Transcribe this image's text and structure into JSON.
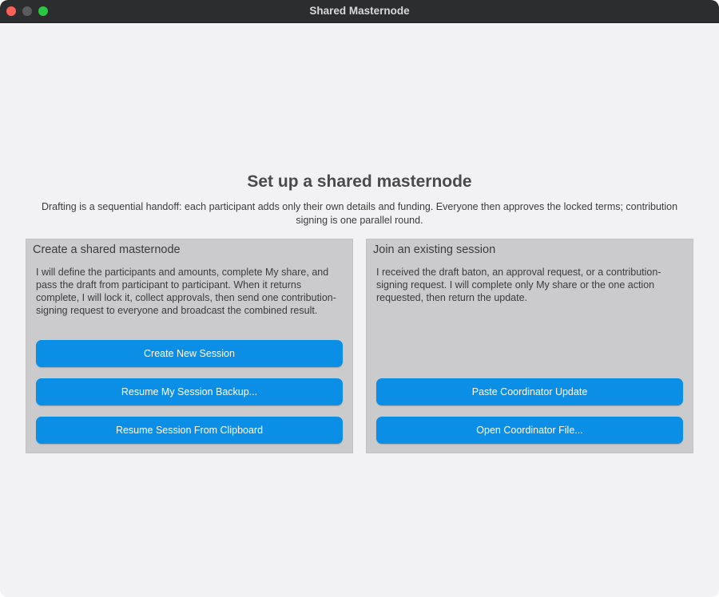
{
  "window": {
    "title": "Shared Masternode",
    "controls": [
      "close",
      "minimize",
      "zoom"
    ]
  },
  "main": {
    "heading": "Set up a shared masternode",
    "subtitle": "Drafting is a sequential handoff: each participant adds only their own details and funding. Everyone then approves the locked terms; contribution signing is one parallel round."
  },
  "create_panel": {
    "title": "Create a shared masternode",
    "description": "I will define the participants and amounts, complete My share, and pass the draft from participant to participant. When it returns complete, I will lock it, collect approvals, then send one contribution-signing request to everyone and broadcast the combined result.",
    "buttons": {
      "create_new": "Create New Session",
      "resume_backup": "Resume My Session Backup...",
      "resume_clipboard": "Resume Session From Clipboard"
    }
  },
  "join_panel": {
    "title": "Join an existing session",
    "description": "I received the draft baton, an approval request, or a contribution-signing request. I will complete only My share or the one action requested, then return the update.",
    "buttons": {
      "paste_update": "Paste Coordinator Update",
      "open_file": "Open Coordinator File..."
    }
  },
  "colors": {
    "button_blue": "#0a8ee6",
    "panel_gray": "#cbcbcd",
    "window_bg": "#f2f2f4",
    "titlebar": "#2b2d2f"
  }
}
